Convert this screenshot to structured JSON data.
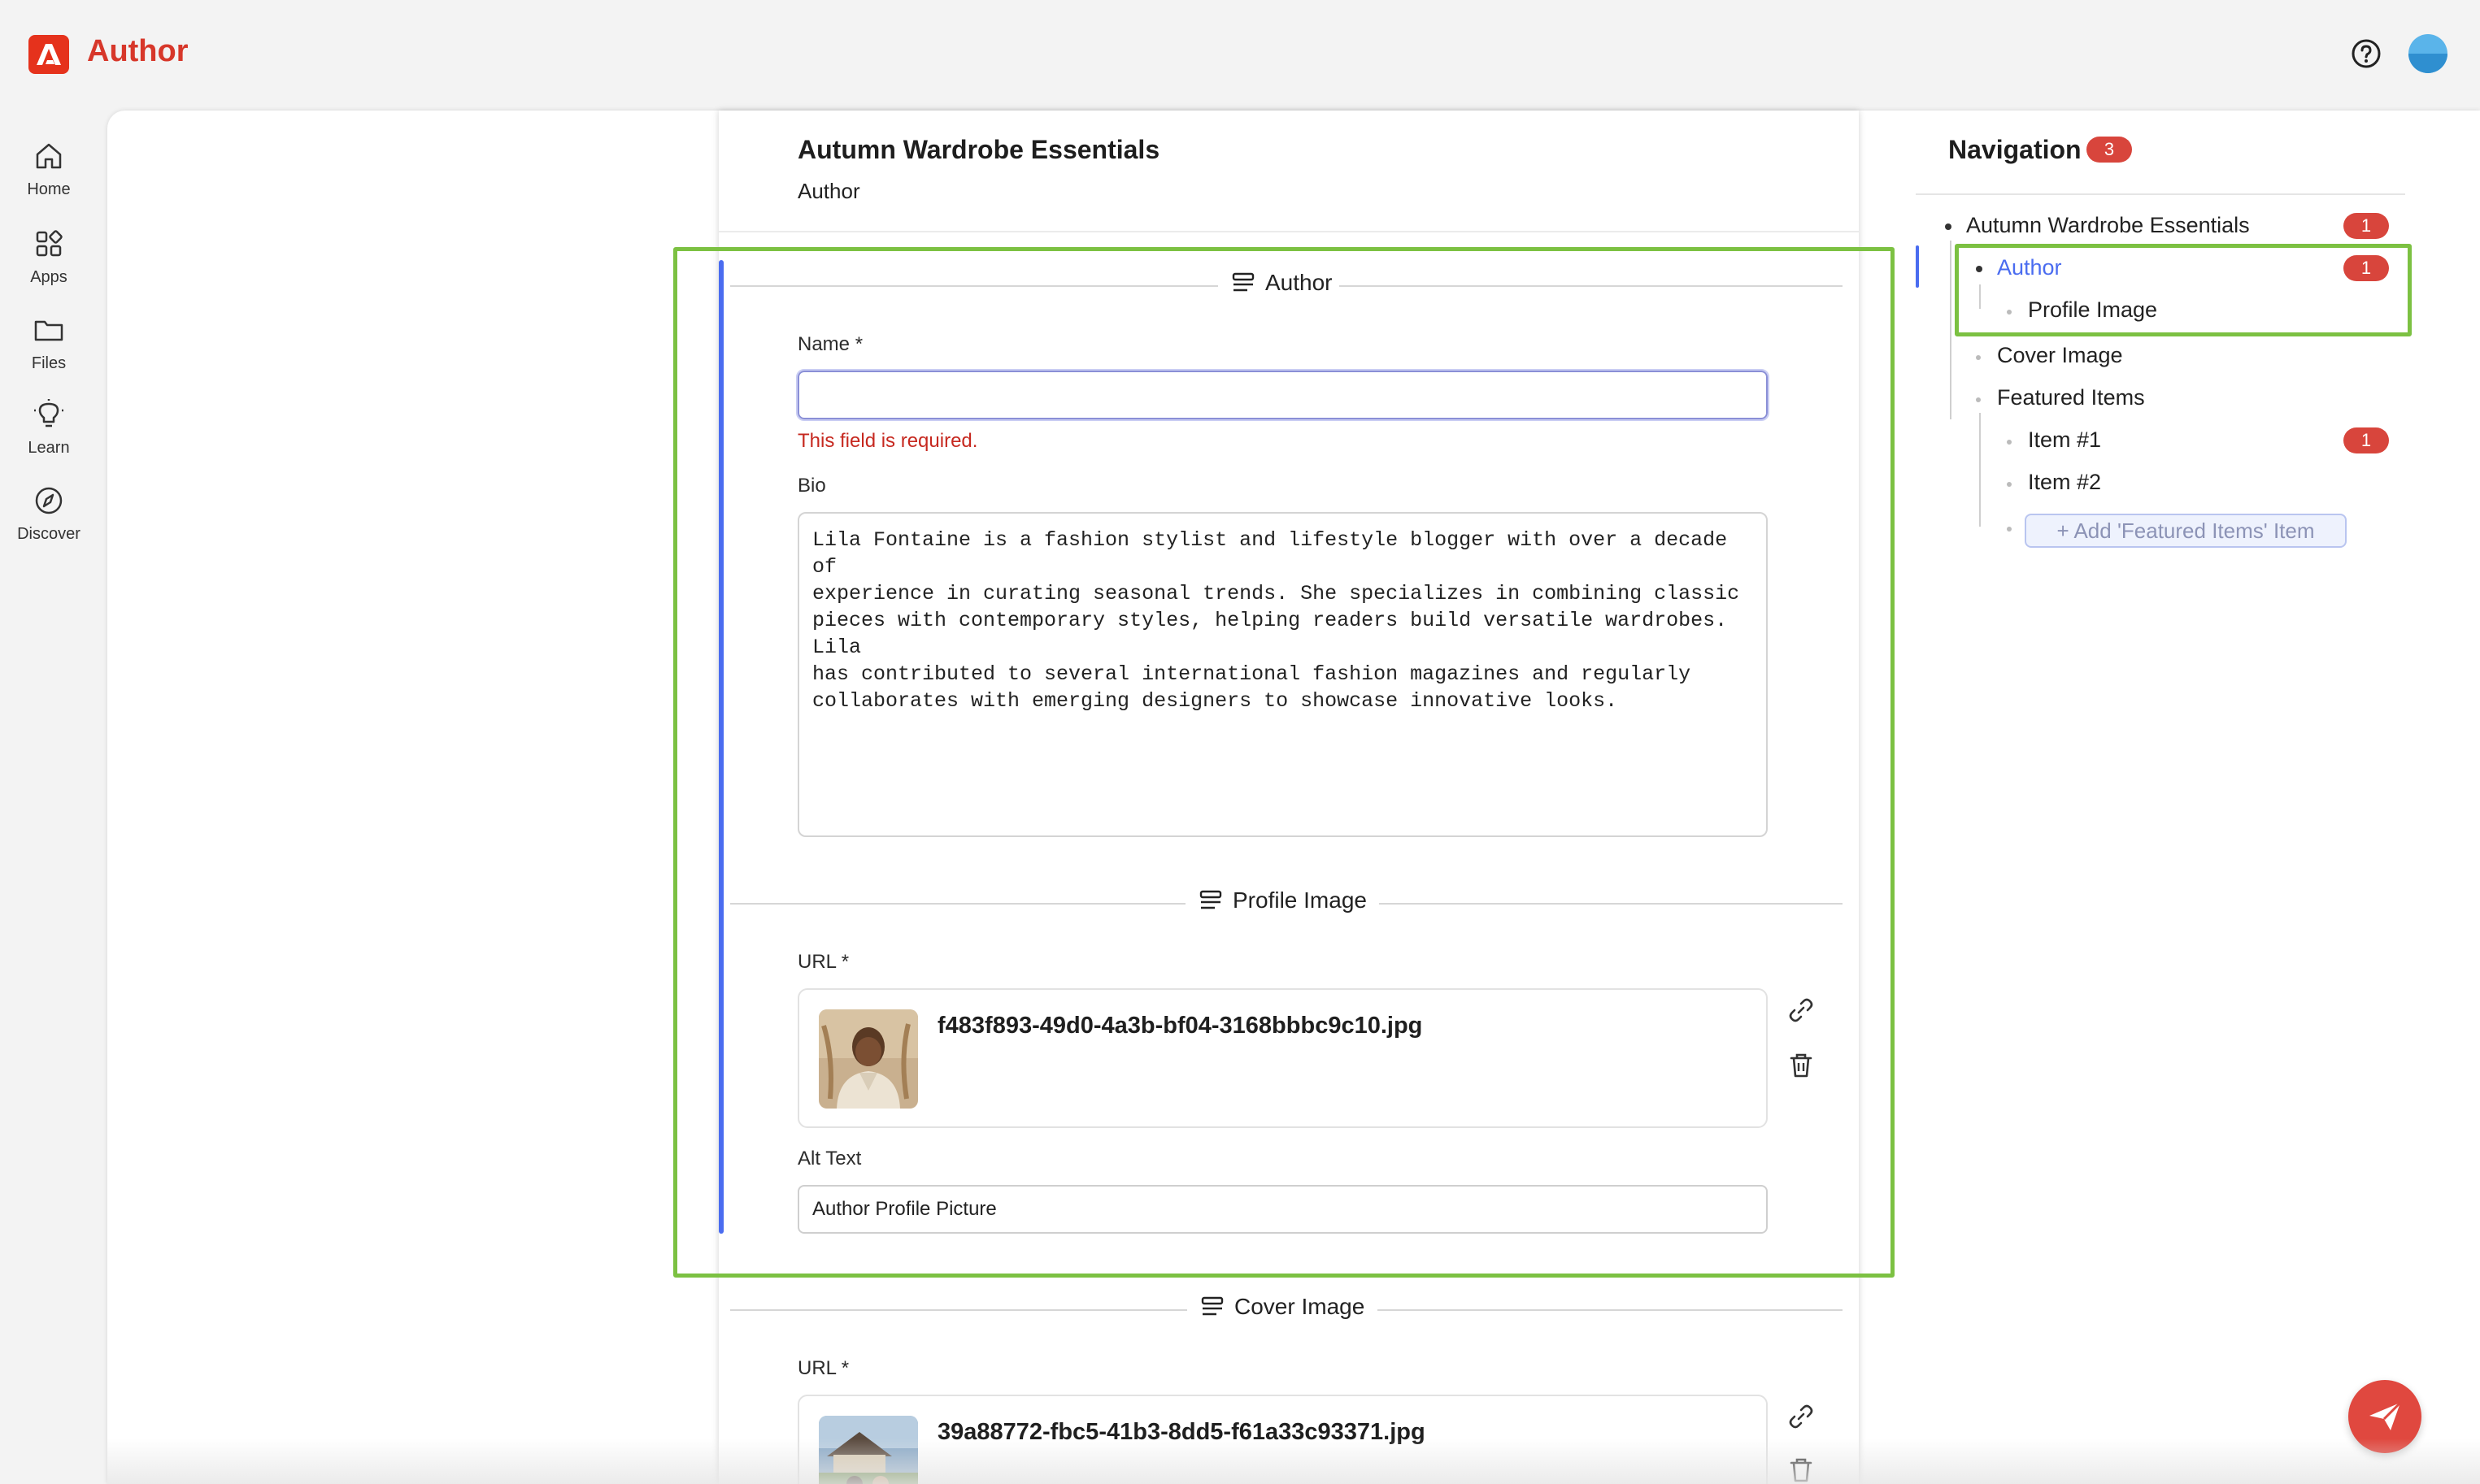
{
  "app": {
    "title": "Author",
    "logo_icon": "adobe-logo-icon"
  },
  "header": {
    "help_icon": "help-circle-icon",
    "avatar_icon": "user-avatar"
  },
  "rail": {
    "items": [
      {
        "label": "Home",
        "icon": "home-icon"
      },
      {
        "label": "Apps",
        "icon": "apps-icon"
      },
      {
        "label": "Files",
        "icon": "folder-icon"
      },
      {
        "label": "Learn",
        "icon": "lightbulb-icon"
      },
      {
        "label": "Discover",
        "icon": "compass-icon"
      }
    ]
  },
  "editor": {
    "title": "Autumn Wardrobe Essentials",
    "subtitle": "Author",
    "sections": {
      "author": {
        "title": "Author",
        "name_label": "Name *",
        "name_value": "",
        "name_error": "This field is required.",
        "bio_label": "Bio",
        "bio_value": "Lila Fontaine is a fashion stylist and lifestyle blogger with over a decade of\nexperience in curating seasonal trends. She specializes in combining classic\npieces with contemporary styles, helping readers build versatile wardrobes. Lila\nhas contributed to several international fashion magazines and regularly\ncollaborates with emerging designers to showcase innovative looks."
      },
      "profile_image": {
        "title": "Profile Image",
        "url_label": "URL *",
        "file_name": "f483f893-49d0-4a3b-bf04-3168bbbc9c10.jpg",
        "alt_label": "Alt Text",
        "alt_value": "Author Profile Picture"
      },
      "cover_image": {
        "title": "Cover Image",
        "url_label": "URL *",
        "file_name": "39a88772-fbc5-41b3-8dd5-f61a33c93371.jpg"
      }
    }
  },
  "navigation": {
    "title": "Navigation",
    "count": "3",
    "tree": {
      "root": {
        "label": "Autumn Wardrobe Essentials",
        "badge": "1"
      },
      "author": {
        "label": "Author",
        "badge": "1"
      },
      "profile_image": {
        "label": "Profile Image"
      },
      "cover_image": {
        "label": "Cover Image"
      },
      "featured_items": {
        "label": "Featured Items"
      },
      "item1": {
        "label": "Item #1",
        "badge": "1"
      },
      "item2": {
        "label": "Item #2"
      },
      "add_button": "+ Add 'Featured Items' Item"
    }
  },
  "colors": {
    "brand": "#e5321c",
    "accent": "#4a6cf0",
    "error": "#c6281f",
    "badge": "#d8453c",
    "highlight": "#7cc142"
  },
  "fab": {
    "icon": "send-icon"
  }
}
